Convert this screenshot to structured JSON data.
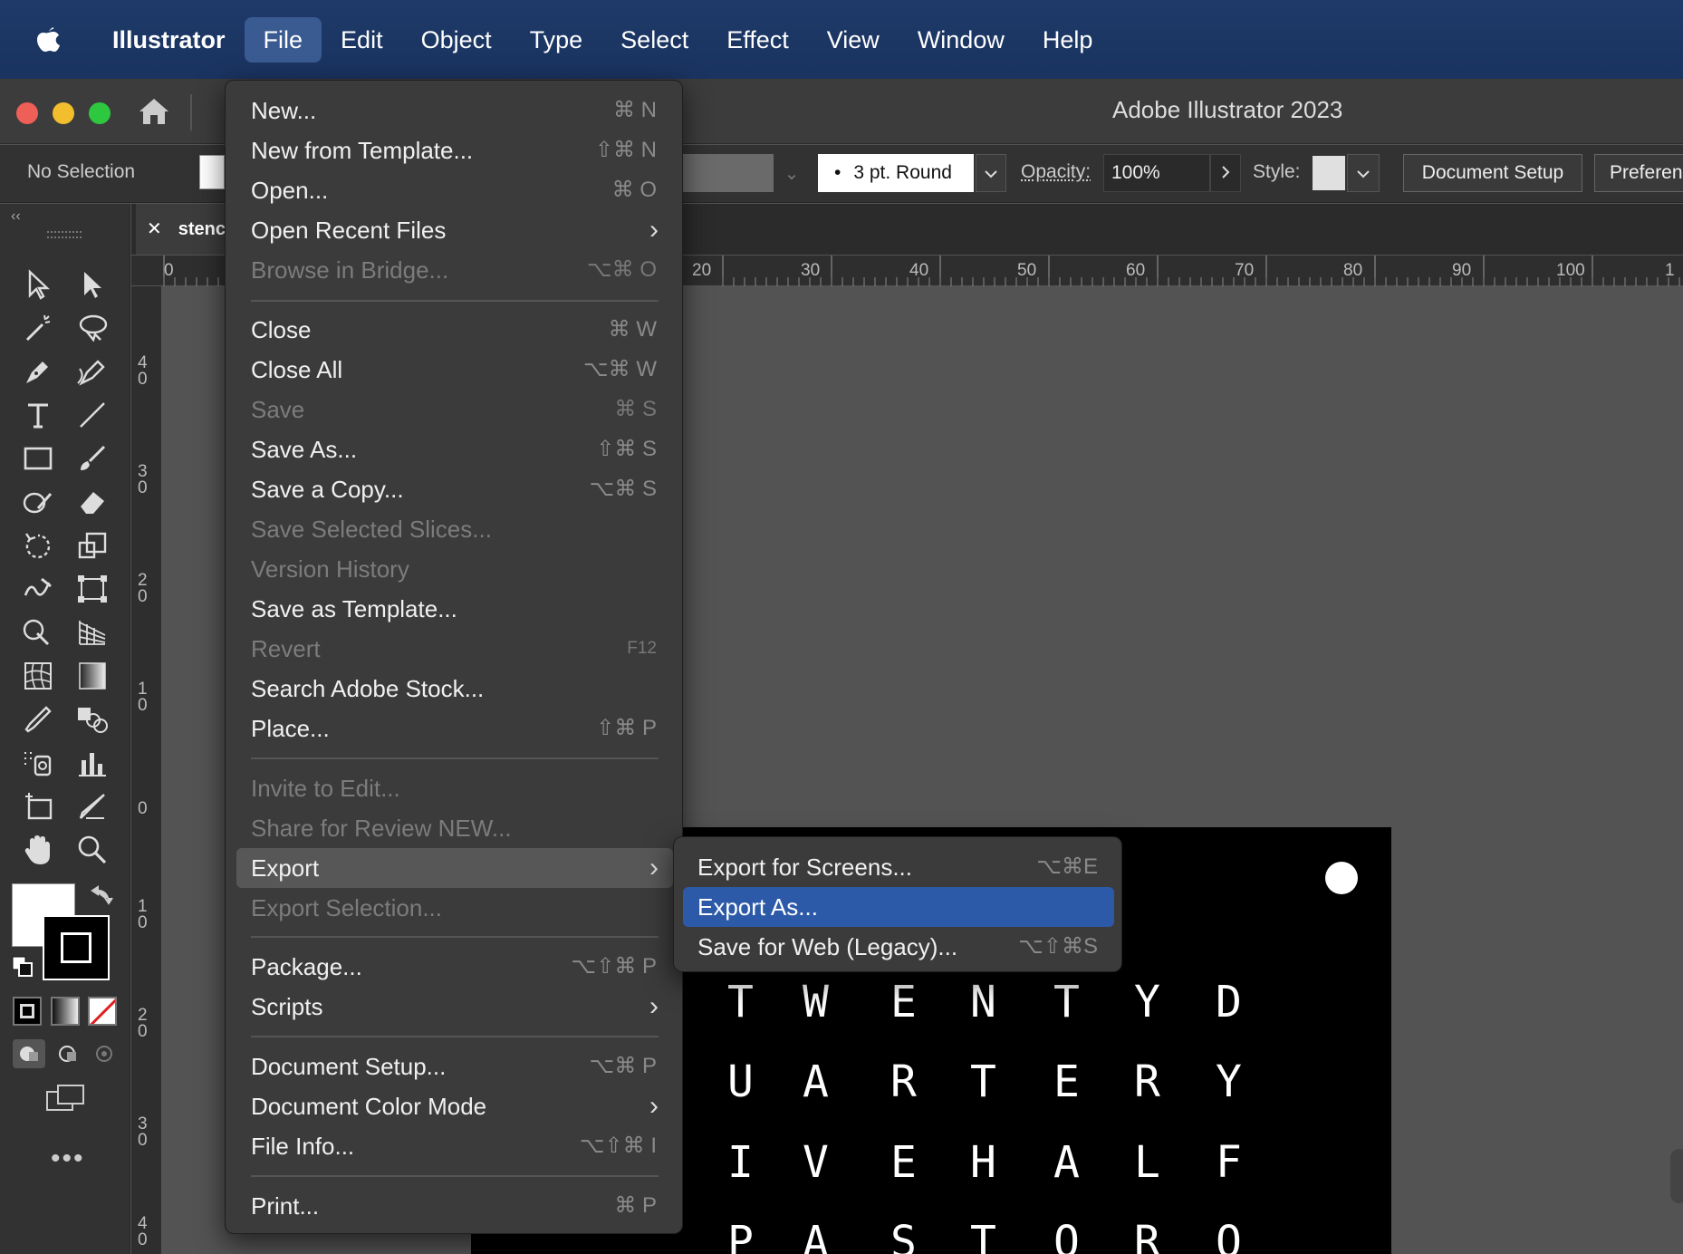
{
  "menubar": {
    "app": "Illustrator",
    "items": [
      "File",
      "Edit",
      "Object",
      "Type",
      "Select",
      "Effect",
      "View",
      "Window",
      "Help"
    ]
  },
  "window": {
    "title": "Adobe Illustrator 2023"
  },
  "control_bar": {
    "selection": "No Selection",
    "brush": "3 pt. Round",
    "opacity_label": "Opacity:",
    "opacity_value": "100%",
    "style_label": "Style:",
    "document_setup": "Document Setup",
    "preferences": "Preferen"
  },
  "document_tab": {
    "name": "stenc"
  },
  "ruler": {
    "h": [
      "0",
      "20",
      "30",
      "40",
      "50",
      "60",
      "70",
      "80",
      "90",
      "100",
      "1"
    ],
    "v": [
      "4\n0",
      "3\n0",
      "2\n0",
      "1\n0",
      "0",
      "1\n0",
      "2\n0",
      "3\n0",
      "4\n0"
    ]
  },
  "file_menu": [
    {
      "label": "New...",
      "shortcut": "⌘ N"
    },
    {
      "label": "New from Template...",
      "shortcut": "⇧⌘ N"
    },
    {
      "label": "Open...",
      "shortcut": "⌘ O"
    },
    {
      "label": "Open Recent Files",
      "submenu": true
    },
    {
      "label": "Browse in Bridge...",
      "shortcut": "⌥⌘ O",
      "disabled": true
    },
    {
      "label": "Close",
      "shortcut": "⌘ W"
    },
    {
      "label": "Close All",
      "shortcut": "⌥⌘ W"
    },
    {
      "label": "Save",
      "shortcut": "⌘ S",
      "disabled": true
    },
    {
      "label": "Save As...",
      "shortcut": "⇧⌘ S"
    },
    {
      "label": "Save a Copy...",
      "shortcut": "⌥⌘ S"
    },
    {
      "label": "Save Selected Slices...",
      "disabled": true
    },
    {
      "label": "Version History",
      "disabled": true
    },
    {
      "label": "Save as Template..."
    },
    {
      "label": "Revert",
      "shortcut": "F12",
      "disabled": true
    },
    {
      "label": "Search Adobe Stock..."
    },
    {
      "label": "Place...",
      "shortcut": "⇧⌘ P"
    },
    {
      "label": "Invite to Edit...",
      "disabled": true
    },
    {
      "label": "Share for Review NEW...",
      "disabled": true
    },
    {
      "label": "Export",
      "submenu": true,
      "highlighted": true
    },
    {
      "label": "Export Selection...",
      "disabled": true
    },
    {
      "label": "Package...",
      "shortcut": "⌥⇧⌘ P"
    },
    {
      "label": "Scripts",
      "submenu": true
    },
    {
      "label": "Document Setup...",
      "shortcut": "⌥⌘ P"
    },
    {
      "label": "Document Color Mode",
      "submenu": true
    },
    {
      "label": "File Info...",
      "shortcut": "⌥⇧⌘ I"
    },
    {
      "label": "Print...",
      "shortcut": "⌘ P"
    }
  ],
  "export_submenu": [
    {
      "label": "Export for Screens...",
      "shortcut": "⌥⌘E"
    },
    {
      "label": "Export As...",
      "selected": true
    },
    {
      "label": "Save for Web (Legacy)...",
      "shortcut": "⌥⇧⌘S"
    }
  ],
  "artboard_letters": [
    [
      "T",
      "W",
      "E",
      "N",
      "T",
      "Y",
      "D"
    ],
    [
      "U",
      "A",
      "R",
      "T",
      "E",
      "R",
      "Y"
    ],
    [
      "I",
      "V",
      "E",
      "H",
      "A",
      "L",
      "F"
    ],
    [
      "P",
      "A",
      "S",
      "T",
      "O",
      "R",
      "O"
    ]
  ],
  "colors": {
    "menubar": "#1e3a68",
    "selection": "#2d5aa8",
    "menu_bg": "#3b3b3b"
  }
}
